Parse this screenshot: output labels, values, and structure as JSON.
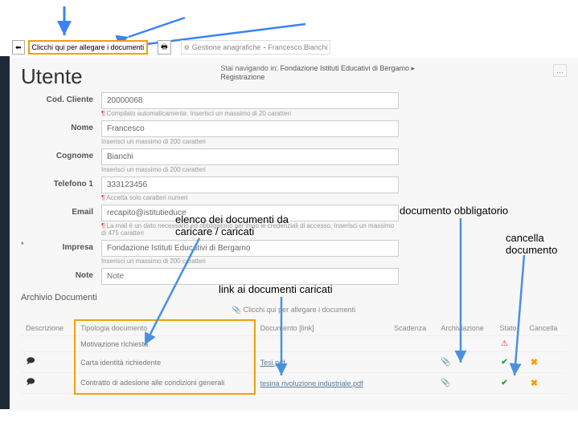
{
  "toolbar": {
    "back_icon": "←",
    "attach_label": "Clicchi qui per allegare i documenti",
    "print_icon": "print",
    "context_prefix": "Gestione anagrafiche",
    "context_user": "Francesco Bianchi"
  },
  "page": {
    "title": "Utente",
    "breadcrumb_prefix": "Stai navigando in:",
    "breadcrumb_org": "Fondazione Istituti Educativi di Bergamo",
    "breadcrumb_step": "Registrazione",
    "dots": "..."
  },
  "form": {
    "cod_cliente": {
      "label": "Cod. Cliente",
      "value": "20000068",
      "hint": "Compilato automaticamente. Inserisci un massimo di 20 caratteri"
    },
    "nome": {
      "label": "Nome",
      "value": "Francesco",
      "hint": "Inserisci un massimo di 200 caratteri"
    },
    "cognome": {
      "label": "Cognome",
      "value": "Bianchi",
      "hint": "Inserisci un massimo di 200 caratteri"
    },
    "telefono": {
      "label": "Telefono 1",
      "value": "333123456",
      "hint": "Accetta solo caratteri numeri"
    },
    "email": {
      "label": "Email",
      "value": "recapito@istitutieduce",
      "hint": "La mail è un dato necessario ed obbligatorio per invio le credenziali di accesso. Inserisci un massimo di 475 caratteri"
    },
    "impresa": {
      "label": "Impresa",
      "value": "Fondazione Istituti Educativi di Bergamo",
      "hint": "Inserisci un massimo di 200 caratteri"
    },
    "note": {
      "label": "Note",
      "placeholder": "Note"
    }
  },
  "archive": {
    "title": "Archivio Documenti",
    "attach_link": "Clicchi qui per allegare i documenti",
    "headers": {
      "descrizione": "Descrizione",
      "tipologia": "Tipologia documento",
      "documento": "Documento [link]",
      "scadenza": "Scadenza",
      "archiviazione": "Archiviazione",
      "stato": "Stato",
      "cancella": "Cancella"
    },
    "rows": [
      {
        "tipologia": "Motivazione richiesta",
        "documento": "",
        "stato_icon": "triangle"
      },
      {
        "tipologia": "Carta identità richiedente",
        "documento": "Tesi.pdf",
        "stato_icon": "check"
      },
      {
        "tipologia": "Contratto di adesione alle condizioni generali",
        "documento": "tesina rivoluzione industriale.pdf",
        "stato_icon": "check"
      }
    ]
  },
  "annotations": {
    "elenco": "elenco dei documenti da caricare / caricati",
    "linkai": "link ai documenti caricati",
    "obbl": "documento obbligatorio",
    "cancella": "cancella documento"
  }
}
